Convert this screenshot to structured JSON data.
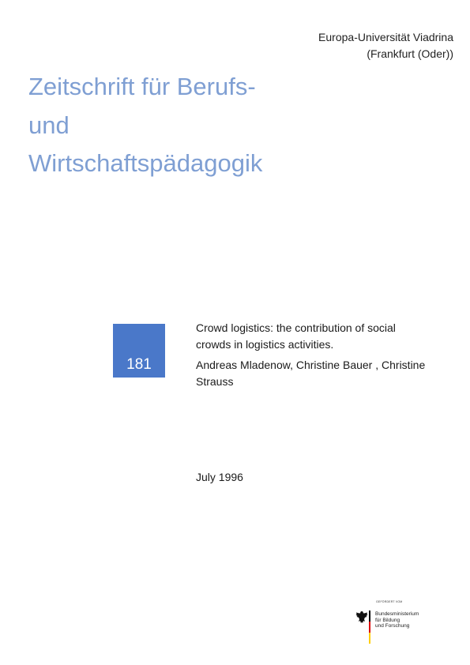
{
  "header": {
    "institution_line1": "Europa-Universität Viadrina",
    "institution_line2": "(Frankfurt (Oder))"
  },
  "journal": {
    "title_line1": "Zeitschrift für Berufs-",
    "title_line2": "und",
    "title_line3": "Wirtschaftspädagogik"
  },
  "issue": {
    "number": "181"
  },
  "paper": {
    "title_line1": "Crowd logistics: the contribution of social",
    "title_line2": "crowds in logistics activities.",
    "authors_line1": "Andreas Mladenow, Christine Bauer , Christine",
    "authors_line2": "Strauss",
    "date": "July 1996"
  },
  "funder": {
    "caption": "GEFÖRDERT VOM",
    "name_line1": "Bundesministerium",
    "name_line2": "für Bildung",
    "name_line3": "und Forschung",
    "icon": "federal-eagle-icon",
    "colors": {
      "black": "#000000",
      "red": "#dd0000",
      "gold": "#ffce00"
    }
  },
  "colors": {
    "title_blue": "#7f9fd3",
    "issue_box": "#4a78c9"
  }
}
